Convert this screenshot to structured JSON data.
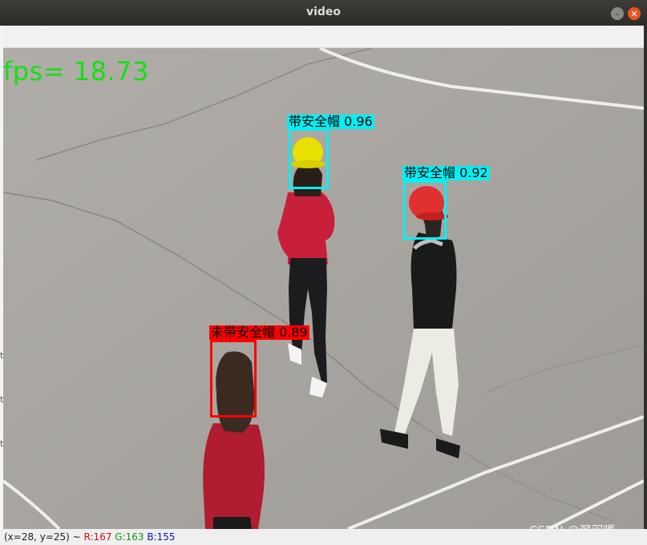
{
  "window": {
    "title": "video"
  },
  "overlay": {
    "fps_text": "fps= 18.73"
  },
  "detections": [
    {
      "label": "带安全帽 0.96",
      "class": "cyan"
    },
    {
      "label": "带安全帽 0.92",
      "class": "cyan"
    },
    {
      "label": "未带安全帽 0.89",
      "class": "red"
    }
  ],
  "colors": {
    "helmet_box": "#00f0f4",
    "no_helmet_box": "#ff0000",
    "fps_text": "#12e012"
  },
  "statusbar": {
    "coords": "(x=28, y=25) ~",
    "r": "R:167",
    "g": "G:163",
    "b": "B:155"
  },
  "watermark": "CSDN @翟羽嚄"
}
